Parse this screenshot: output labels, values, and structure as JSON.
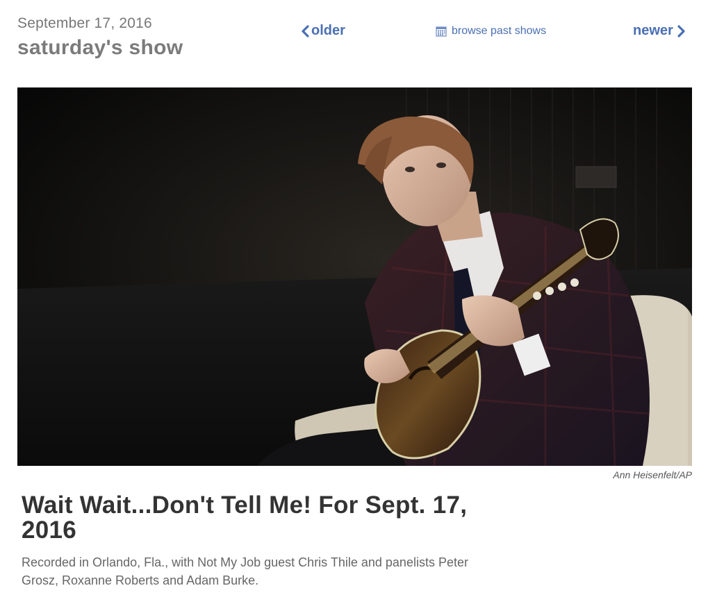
{
  "header": {
    "date": "September 17, 2016",
    "title": "saturday's show"
  },
  "nav": {
    "older_label": "older",
    "browse_label": "browse past shows",
    "newer_label": "newer",
    "link_color": "#4a6fb3",
    "older_icon": "chevron-left-icon",
    "browse_icon": "calendar-icon",
    "newer_icon": "chevron-right-icon"
  },
  "photo": {
    "credit": "Ann Heisenfelt/AP"
  },
  "article": {
    "headline": "Wait Wait...Don't Tell Me! For Sept. 17, 2016",
    "description": "Recorded in Orlando, Fla., with Not My Job guest Chris Thile and panelists Peter Grosz, Roxanne Roberts and Adam Burke."
  }
}
